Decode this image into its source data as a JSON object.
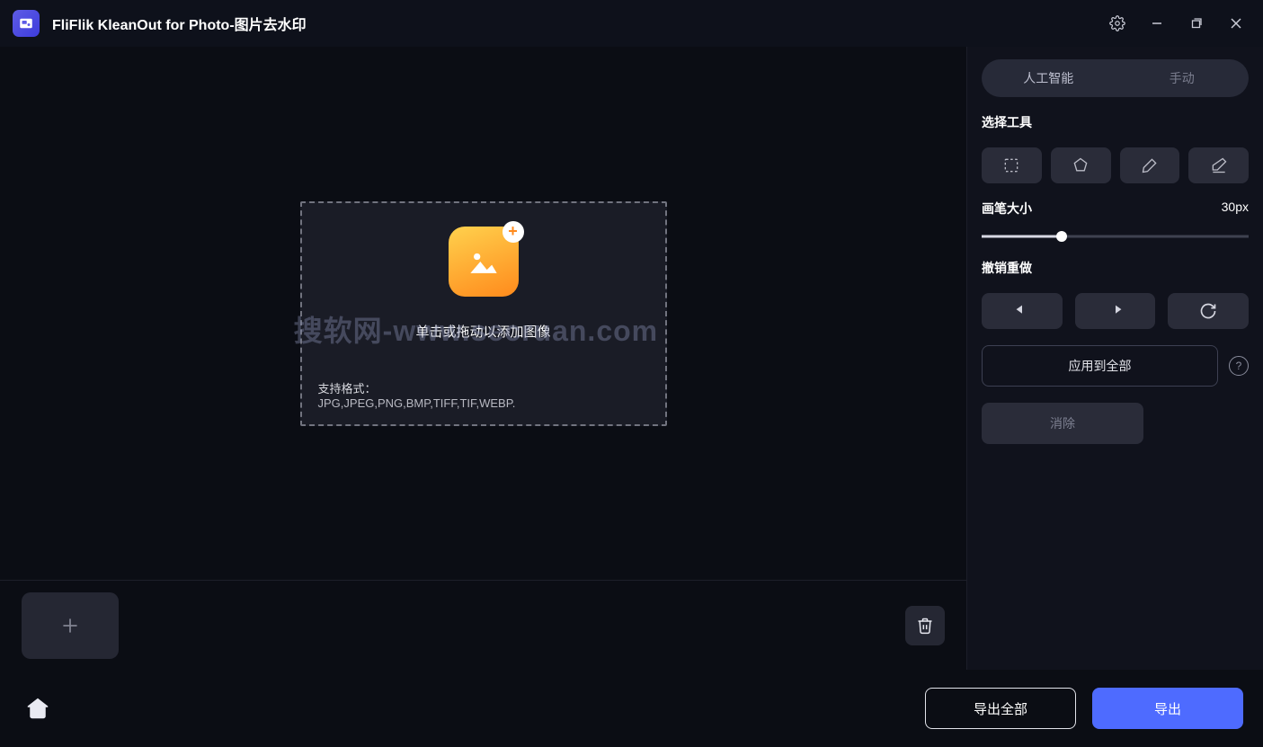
{
  "titlebar": {
    "title": "FliFlik KleanOut for Photo-图片去水印"
  },
  "dropzone": {
    "headline": "单击或拖动以添加图像",
    "sublabel": "支持格式：",
    "formats": "JPG,JPEG,PNG,BMP,TIFF,TIF,WEBP."
  },
  "watermark": "搜软网-www.secruan.com",
  "panel": {
    "tabs": {
      "ai": "人工智能",
      "manual": "手动"
    },
    "select_tool": "选择工具",
    "brush_label": "画笔大小",
    "brush_value": "30px",
    "brush_percent": 30,
    "undo_redo": "撤销重做",
    "apply_all": "应用到全部",
    "remove": "消除"
  },
  "footer": {
    "export_all": "导出全部",
    "export": "导出"
  }
}
